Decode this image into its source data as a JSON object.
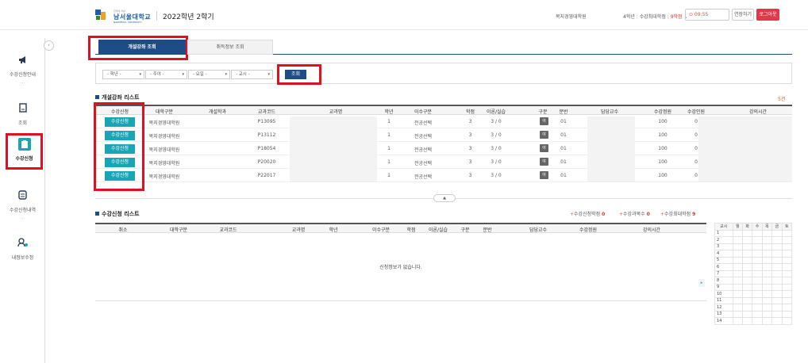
{
  "header": {
    "school_name_small": "한국의 자랑",
    "school_name": "남서울대학교",
    "school_name_en": "NAMSEOUL UNIVERSITY",
    "term": "2022학년 2학기",
    "department": "복지경영대학원",
    "grade": "4학년",
    "max_credits_label": "수강최대학점 : ",
    "max_credits_value": "9학점",
    "timer": "⊙ 09:55",
    "extend_label": "연장하기",
    "logout_label": "로그아웃"
  },
  "sidebar": {
    "items": [
      {
        "label": "수강신청안내",
        "icon": "megaphone-icon"
      },
      {
        "label": "조회",
        "icon": "document-icon"
      },
      {
        "label": "수강신청",
        "icon": "register-icon"
      },
      {
        "label": "수강신청내역",
        "icon": "history-icon"
      },
      {
        "label": "내정보수정",
        "icon": "user-settings-icon"
      }
    ]
  },
  "tabs": [
    {
      "label": "개설강좌 조회"
    },
    {
      "label": "취득정보 조회"
    }
  ],
  "filters": {
    "selects": [
      "- 학년 -",
      "- 주야 -",
      "- 요일 -",
      "- 교시 -"
    ],
    "search_label": "조회"
  },
  "course_list": {
    "title": "개설강좌 리스트",
    "count": "5건",
    "columns": [
      "수강신청",
      "대학구분",
      "개설학과",
      "교과코드",
      "교과명",
      "학년",
      "이수구분",
      "학점",
      "이론/실습",
      "구분",
      "분반",
      "담당교수",
      "수강정원",
      "수강인원",
      "강의시간"
    ],
    "rows": [
      {
        "apply": "수강신청",
        "college": "복지경영대학원",
        "dept": "",
        "code": "P13095",
        "name": "",
        "grade": "1",
        "type": "전공선택",
        "credit": "3",
        "theory": "3 / 0",
        "kind": "야",
        "section": "01",
        "prof": "",
        "cap": "100",
        "enrolled": "0",
        "time": ""
      },
      {
        "apply": "수강신청",
        "college": "복지경영대학원",
        "dept": "",
        "code": "P13112",
        "name": "",
        "grade": "1",
        "type": "전공선택",
        "credit": "3",
        "theory": "3 / 0",
        "kind": "야",
        "section": "01",
        "prof": "",
        "cap": "100",
        "enrolled": "0",
        "time": ""
      },
      {
        "apply": "수강신청",
        "college": "복지경영대학원",
        "dept": "",
        "code": "P18054",
        "name": "",
        "grade": "1",
        "type": "전공선택",
        "credit": "3",
        "theory": "3 / 0",
        "kind": "야",
        "section": "01",
        "prof": "",
        "cap": "100",
        "enrolled": "0",
        "time": ""
      },
      {
        "apply": "수강신청",
        "college": "복지경영대학원",
        "dept": "",
        "code": "P20020",
        "name": "",
        "grade": "1",
        "type": "전공선택",
        "credit": "3",
        "theory": "3 / 0",
        "kind": "야",
        "section": "01",
        "prof": "",
        "cap": "100",
        "enrolled": "0",
        "time": ""
      },
      {
        "apply": "수강신청",
        "college": "복지경영대학원",
        "dept": "",
        "code": "P22017",
        "name": "",
        "grade": "1",
        "type": "전공선택",
        "credit": "3",
        "theory": "3 / 0",
        "kind": "야",
        "section": "01",
        "prof": "",
        "cap": "100",
        "enrolled": "0",
        "time": ""
      }
    ]
  },
  "collapse_label": "▲",
  "registered_list": {
    "title": "수강신청 리스트",
    "summary": [
      {
        "label": "수강신청학점",
        "value": "0"
      },
      {
        "label": "수강과목수",
        "value": "0"
      },
      {
        "label": "수강최대학점",
        "value": "9"
      }
    ],
    "columns": [
      "취소",
      "대학구분",
      "교과코드",
      "교과명",
      "학년",
      "이수구분",
      "학점",
      "이론/실습",
      "구분",
      "분반",
      "담당교수",
      "수강정원",
      "강의시간"
    ],
    "empty_message": "신청정보가 없습니다."
  },
  "timetable": {
    "columns": [
      "교시",
      "월",
      "화",
      "수",
      "목",
      "금",
      "토"
    ],
    "periods": [
      "1",
      "2",
      "3",
      "4",
      "5",
      "6",
      "7",
      "8",
      "9",
      "10",
      "11",
      "12",
      "13",
      "14"
    ]
  },
  "colors": {
    "primary": "#1e4c87",
    "accent": "#1aa5b6",
    "logout": "#e2384c",
    "highlight_box": "#e01020"
  }
}
